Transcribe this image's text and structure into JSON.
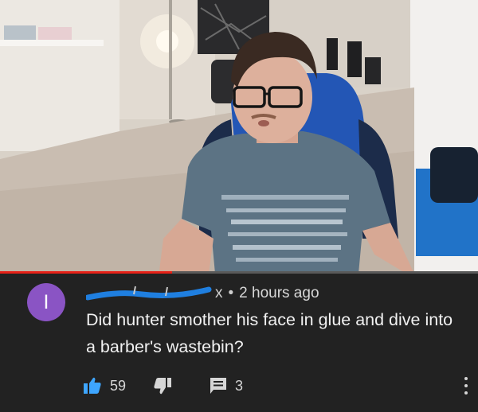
{
  "comment": {
    "avatar_letter": "I",
    "avatar_color": "#8a54c4",
    "author_visible_tail": "x",
    "author_redaction_color": "#1f7fe0",
    "separator": "•",
    "timestamp": "2 hours ago",
    "text": "Did hunter smother his face in glue and dive into a barber's wastebin?",
    "like_count": "59",
    "reply_count": "3",
    "icons": {
      "like": "thumbs-up-icon",
      "dislike": "thumbs-down-icon",
      "reply": "reply-icon",
      "more": "more-vertical-icon"
    }
  },
  "video": {
    "progress_fraction": 0.36,
    "progress_color": "#e62117"
  }
}
